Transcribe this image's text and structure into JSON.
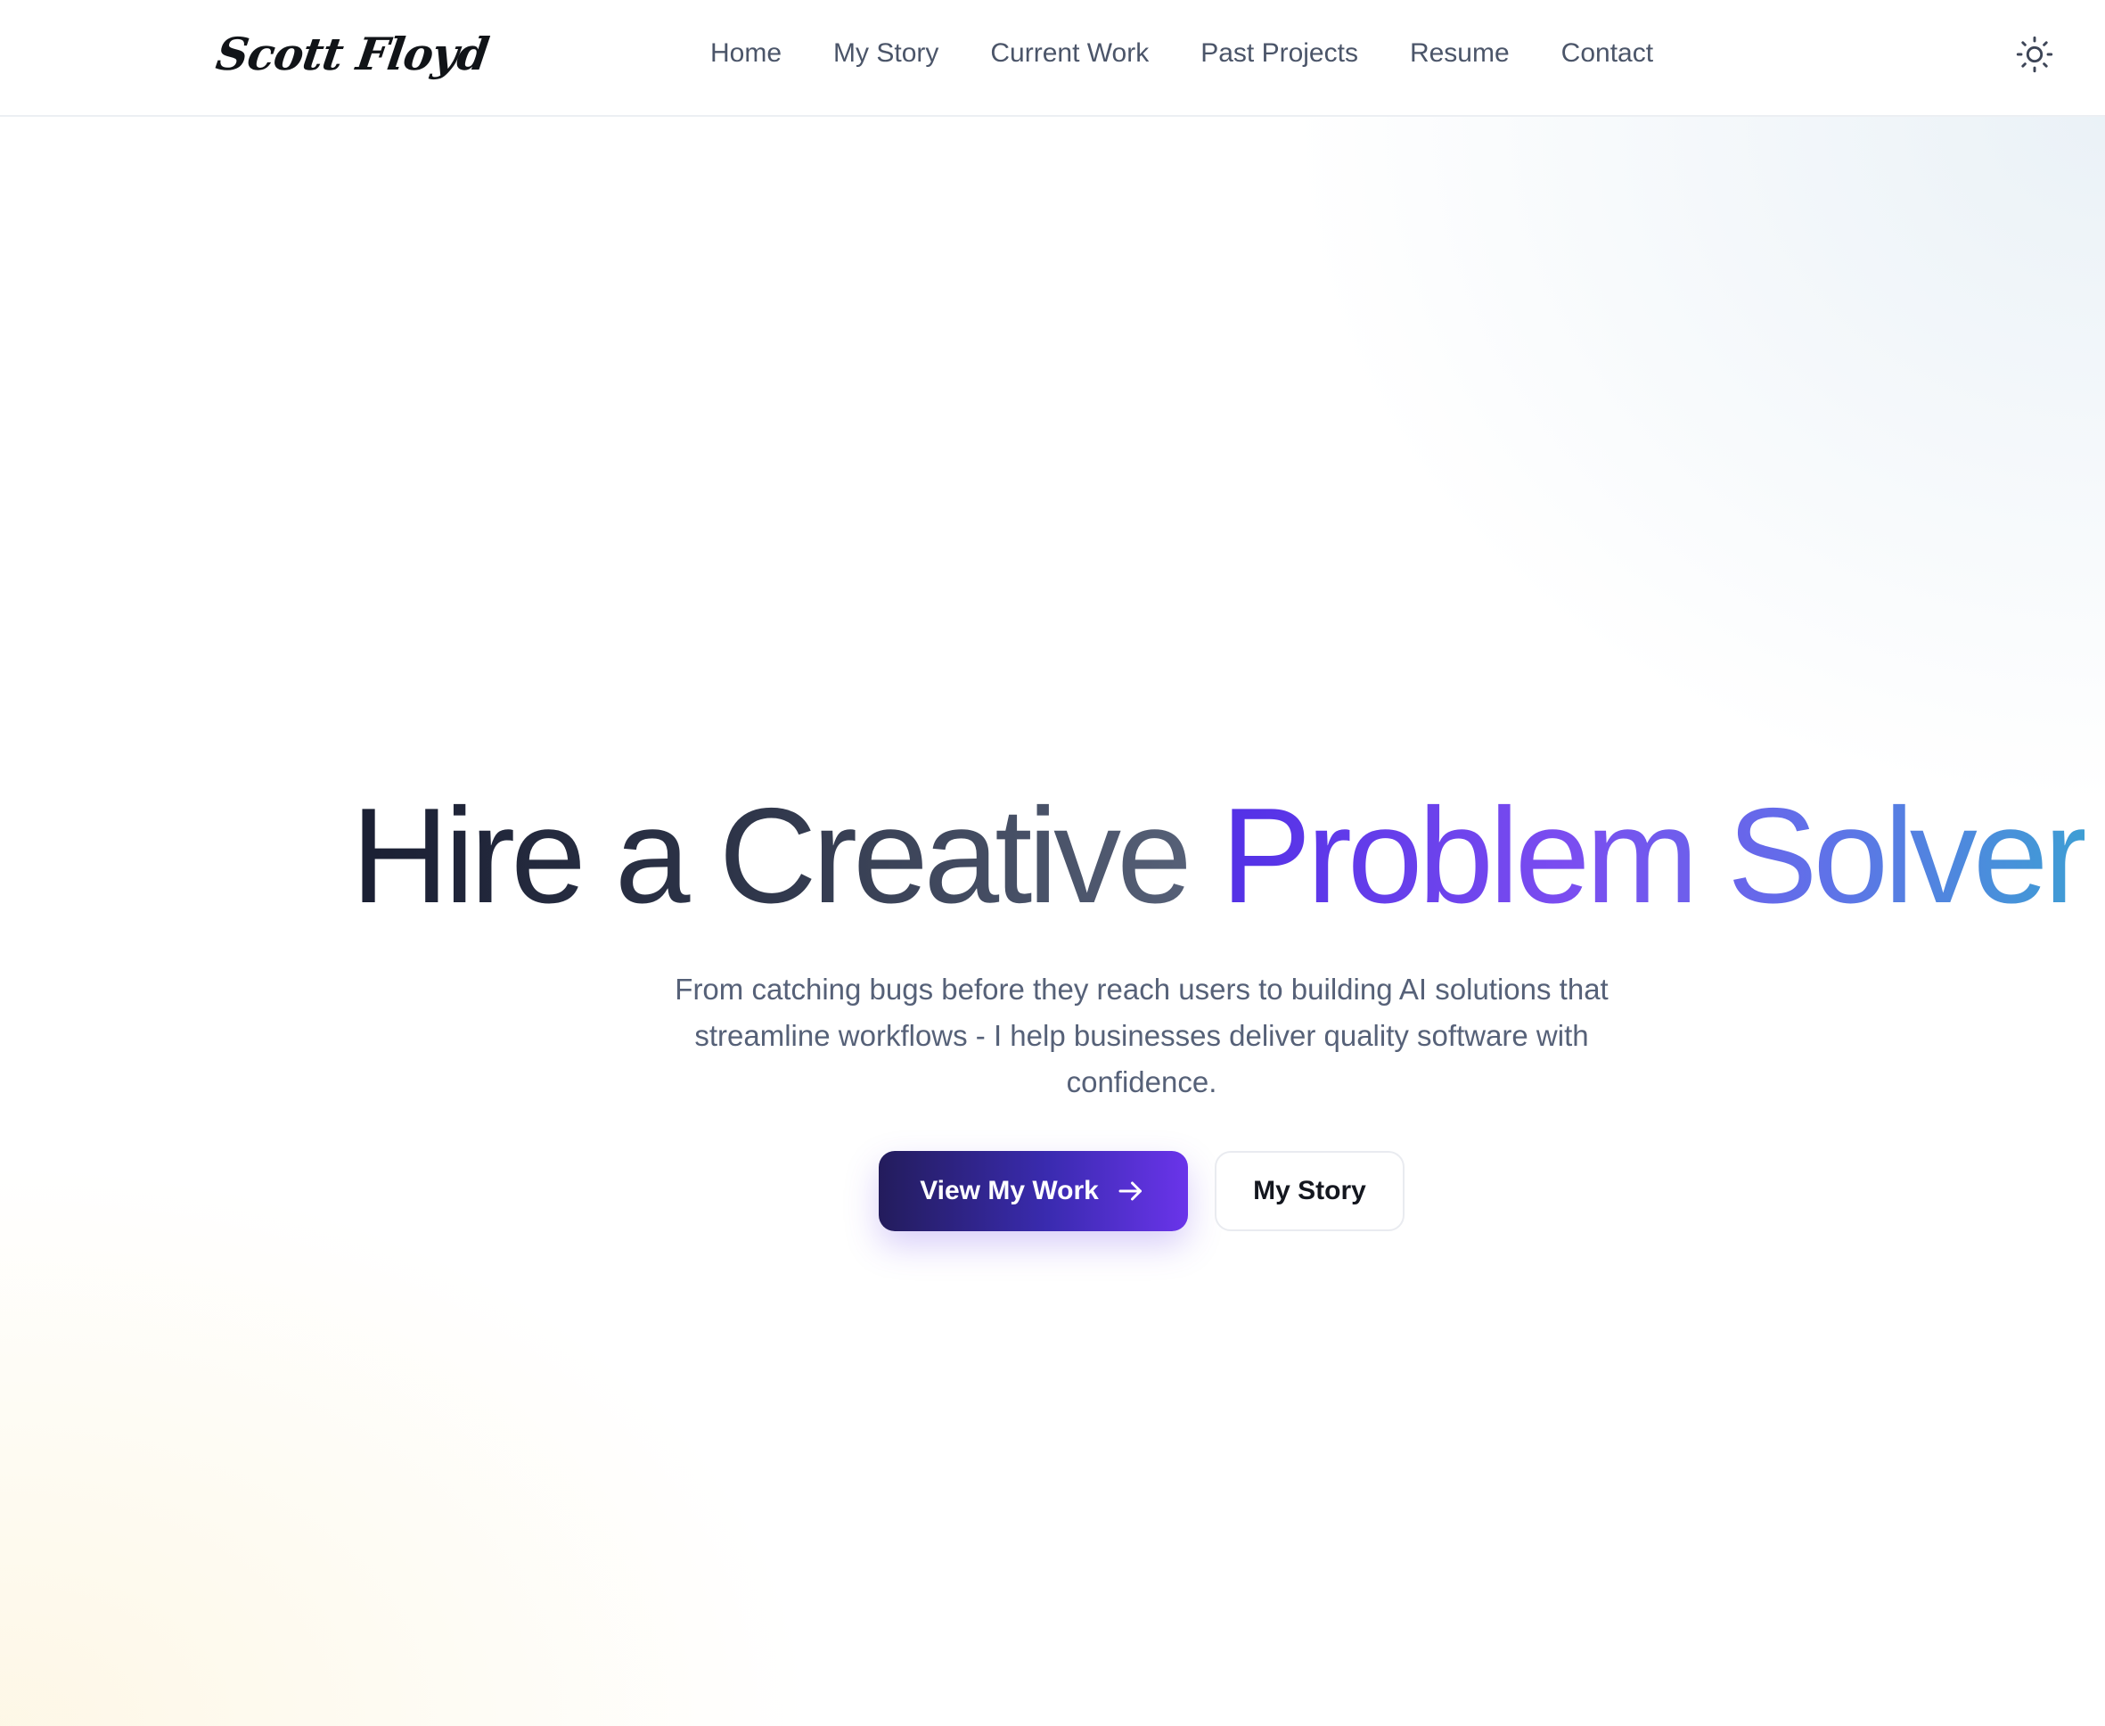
{
  "header": {
    "logo_text": "Scott Floyd",
    "nav": [
      {
        "label": "Home"
      },
      {
        "label": "My Story"
      },
      {
        "label": "Current Work"
      },
      {
        "label": "Past Projects"
      },
      {
        "label": "Resume"
      },
      {
        "label": "Contact"
      }
    ],
    "theme_toggle_icon": "sun-icon"
  },
  "hero": {
    "title_plain": "Hire a Creative",
    "title_highlight": "Problem Solver",
    "subtitle": "From catching bugs before they reach users to building AI solutions that streamline workflows - I help businesses deliver quality software with confidence.",
    "primary_button": {
      "label": "View My Work",
      "icon": "arrow-right-icon"
    },
    "secondary_button": {
      "label": "My Story"
    }
  },
  "colors": {
    "accent_start": "#5230e6",
    "accent_end": "#3e9ed4",
    "button_dark": "#231c5c",
    "button_purple": "#6a34ea",
    "nav_text": "#4b5569",
    "body_text": "#566178"
  }
}
